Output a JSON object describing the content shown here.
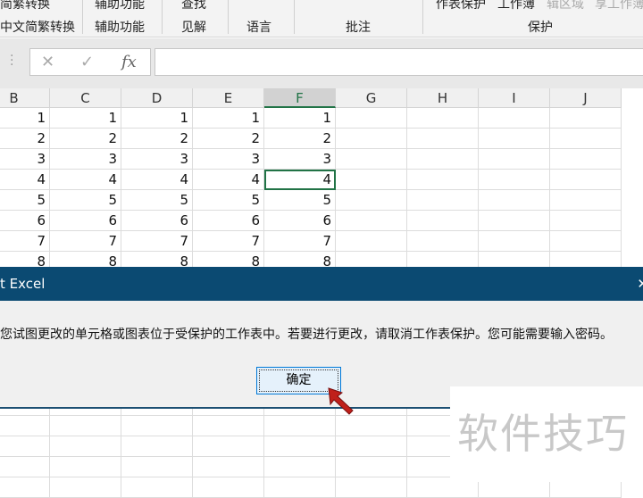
{
  "ribbon": {
    "top_items": [
      "简繁转换",
      "辅助功能",
      "查找",
      "作表保护",
      "工作簿",
      "辑区域",
      "享工作簿"
    ],
    "groups": [
      "中文简繁转换",
      "辅助功能",
      "见解",
      "语言",
      "批注",
      "保护"
    ]
  },
  "formula_bar": {
    "cancel": "✕",
    "enter": "✓",
    "fx": "fx",
    "value": ""
  },
  "columns": [
    "B",
    "C",
    "D",
    "E",
    "F",
    "G",
    "H",
    "I",
    "J"
  ],
  "selected_column": "F",
  "rows": [
    [
      "1",
      "1",
      "1",
      "1",
      "1"
    ],
    [
      "2",
      "2",
      "2",
      "2",
      "2"
    ],
    [
      "3",
      "3",
      "3",
      "3",
      "3"
    ],
    [
      "4",
      "4",
      "4",
      "4",
      "4"
    ],
    [
      "5",
      "5",
      "5",
      "5",
      "5"
    ],
    [
      "6",
      "6",
      "6",
      "6",
      "6"
    ],
    [
      "7",
      "7",
      "7",
      "7",
      "7"
    ],
    [
      "8",
      "8",
      "8",
      "8",
      "8"
    ]
  ],
  "dialog": {
    "title": "t Excel",
    "close": "✕",
    "message": "您试图更改的单元格或图表位于受保护的工作表中。若要进行更改，请取消工作表保护。您可能需要输入密码。",
    "ok_label": "确定"
  },
  "watermark": "软件技巧",
  "colors": {
    "dialog_title": "#0b4a72",
    "selection": "#217346",
    "pointer": "#c0201a"
  }
}
